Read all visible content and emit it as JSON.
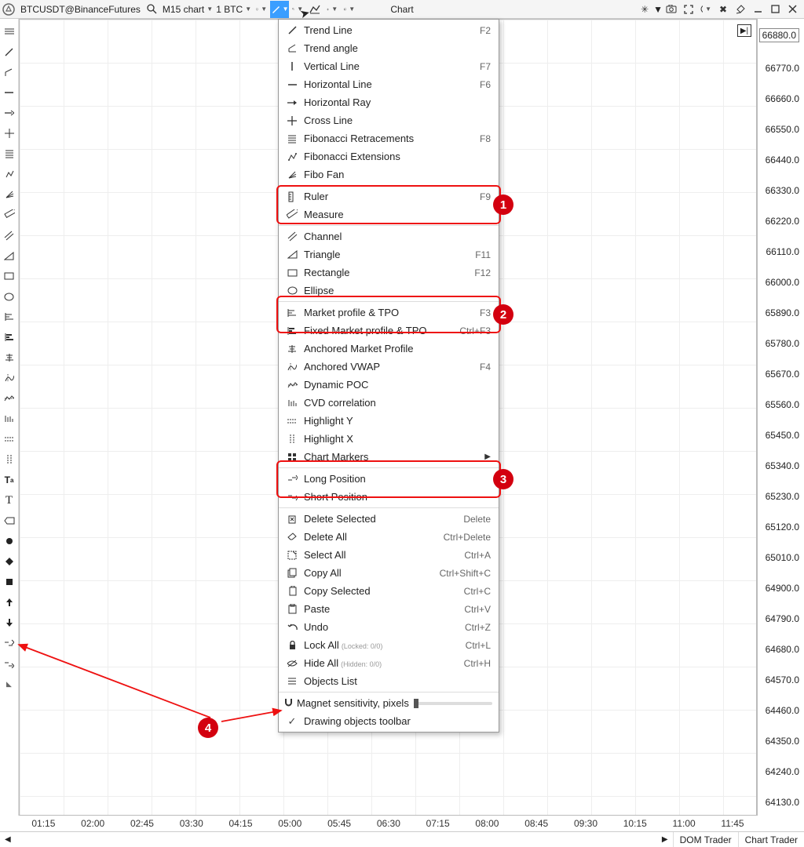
{
  "topbar": {
    "symbol": "BTCUSDT@BinanceFutures",
    "timeframe": "M15 chart",
    "qty": "1 BTC",
    "title": "Chart"
  },
  "menu": {
    "trendline": {
      "label": "Trend Line",
      "hint": "F2"
    },
    "trendangle": {
      "label": "Trend angle",
      "hint": ""
    },
    "vline": {
      "label": "Vertical Line",
      "hint": "F7"
    },
    "hline": {
      "label": "Horizontal Line",
      "hint": "F6"
    },
    "hray": {
      "label": "Horizontal Ray",
      "hint": ""
    },
    "cross": {
      "label": "Cross Line",
      "hint": ""
    },
    "fibr": {
      "label": "Fibonacci Retracements",
      "hint": "F8"
    },
    "fibe": {
      "label": "Fibonacci Extensions",
      "hint": ""
    },
    "fibf": {
      "label": "Fibo Fan",
      "hint": ""
    },
    "ruler": {
      "label": "Ruler",
      "hint": "F9"
    },
    "measure": {
      "label": "Measure",
      "hint": ""
    },
    "channel": {
      "label": "Channel",
      "hint": ""
    },
    "triangle": {
      "label": "Triangle",
      "hint": "F11"
    },
    "rect": {
      "label": "Rectangle",
      "hint": "F12"
    },
    "ellipse": {
      "label": "Ellipse",
      "hint": ""
    },
    "mptpo": {
      "label": "Market profile & TPO",
      "hint": "F3"
    },
    "fmptpo": {
      "label": "Fixed Market profile & TPO",
      "hint": "Ctrl+F3"
    },
    "amp": {
      "label": "Anchored Market Profile",
      "hint": ""
    },
    "avwap": {
      "label": "Anchored VWAP",
      "hint": "F4"
    },
    "dpoc": {
      "label": "Dynamic POC",
      "hint": ""
    },
    "cvd": {
      "label": "CVD correlation",
      "hint": ""
    },
    "hly": {
      "label": "Highlight Y",
      "hint": ""
    },
    "hlx": {
      "label": "Highlight X",
      "hint": ""
    },
    "markers": {
      "label": "Chart Markers",
      "hint": ""
    },
    "long": {
      "label": "Long Position",
      "hint": ""
    },
    "short": {
      "label": "Short Position",
      "hint": ""
    },
    "delsel": {
      "label": "Delete Selected",
      "hint": "Delete"
    },
    "delall": {
      "label": "Delete All",
      "hint": "Ctrl+Delete"
    },
    "selall": {
      "label": "Select All",
      "hint": "Ctrl+A"
    },
    "copyall": {
      "label": "Copy All",
      "hint": "Ctrl+Shift+C"
    },
    "copysel": {
      "label": "Copy Selected",
      "hint": "Ctrl+C"
    },
    "paste": {
      "label": "Paste",
      "hint": "Ctrl+V"
    },
    "undo": {
      "label": "Undo",
      "hint": "Ctrl+Z"
    },
    "lockall": {
      "label": "Lock All",
      "sub": "(Locked: 0/0)",
      "hint": "Ctrl+L"
    },
    "hideall": {
      "label": "Hide All",
      "sub": "(Hidden: 0/0)",
      "hint": "Ctrl+H"
    },
    "objlist": {
      "label": "Objects List",
      "hint": ""
    },
    "magnet": {
      "label": "Magnet sensitivity, pixels"
    },
    "drawtoolbar": {
      "label": "Drawing objects toolbar"
    }
  },
  "yaxis": [
    "66880.0",
    "66770.0",
    "66660.0",
    "66550.0",
    "66440.0",
    "66330.0",
    "66220.0",
    "66110.0",
    "66000.0",
    "65890.0",
    "65780.0",
    "65670.0",
    "65560.0",
    "65450.0",
    "65340.0",
    "65230.0",
    "65120.0",
    "65010.0",
    "64900.0",
    "64790.0",
    "64680.0",
    "64570.0",
    "64460.0",
    "64350.0",
    "64240.0",
    "64130.0"
  ],
  "xaxis": [
    "01:15",
    "02:00",
    "02:45",
    "03:30",
    "04:15",
    "05:00",
    "05:45",
    "06:30",
    "07:15",
    "08:00",
    "08:45",
    "09:30",
    "10:15",
    "11:00",
    "11:45"
  ],
  "statusbar": {
    "dom": "DOM Trader",
    "ct": "Chart Trader"
  },
  "annot": {
    "n1": "1",
    "n2": "2",
    "n3": "3",
    "n4": "4"
  }
}
